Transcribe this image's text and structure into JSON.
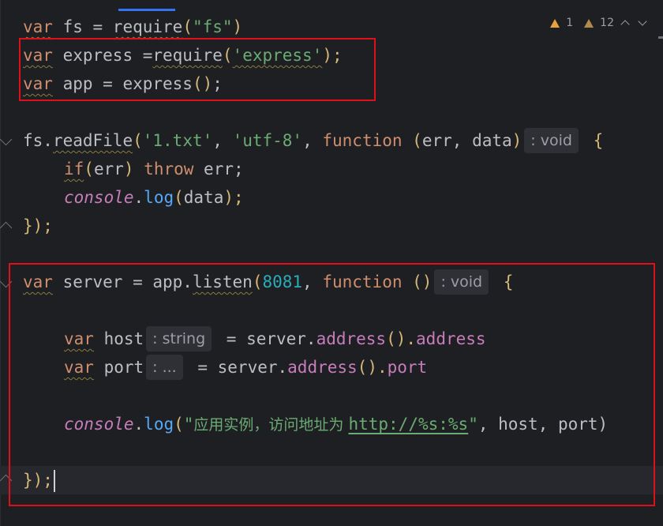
{
  "inspections": {
    "warnings_count": "1",
    "weak_warnings_count": "12"
  },
  "hints": {
    "void1": ": void",
    "void2": ": void",
    "string": ": string",
    "ellipsis": ": ..."
  },
  "code": {
    "l1": {
      "t1": "var",
      "t2": " fs = ",
      "t3": "require",
      "t4": "(",
      "t5": "\"fs\"",
      "t6": ")"
    },
    "l2": {
      "t1": "var",
      "t2": " express =",
      "t3": "require",
      "t4": "(",
      "t5": "'express'",
      "t6": ");"
    },
    "l3": {
      "t1": "var",
      "t2": " app = express",
      "t3": "()",
      "t4": ";"
    },
    "l5": {
      "t1": "fs.",
      "t2": "readFile",
      "t3": "(",
      "t4": "'1.txt'",
      "t5": ", ",
      "t6": "'utf-8'",
      "t7": ", ",
      "t8": "function",
      "t9": " (",
      "t10": "err",
      "t11": ", ",
      "t12": "data",
      "t13": ")",
      "t14": " {"
    },
    "l6": {
      "t1": "if",
      "t2": "(",
      "t3": "err",
      "t4": ")",
      "t5": " throw",
      "t6": " err;"
    },
    "l7": {
      "t1": "console",
      "t2": ".",
      "t3": "log",
      "t4": "(",
      "t5": "data",
      "t6": ");"
    },
    "l8": {
      "t1": "}",
      "t2": ");"
    },
    "l10": {
      "t1": "var",
      "t2": " server = app.",
      "t3": "listen",
      "t4": "(",
      "t5": "8081",
      "t6": ", ",
      "t7": "function",
      "t8": " ()",
      "t9": " {"
    },
    "l12": {
      "t1": "var",
      "t2": " host",
      "t3": " = server.",
      "t4": "address",
      "t5": "().",
      "t6": "address"
    },
    "l13": {
      "t1": "var",
      "t2": " port",
      "t3": " = server.",
      "t4": "address",
      "t5": "().",
      "t6": "port"
    },
    "l15": {
      "t1": "console",
      "t2": ".",
      "t3": "log",
      "t4": "(",
      "t5": "\"",
      "t6": "应用实例，访问地址为 ",
      "t7": "http://%s:%s",
      "t8": "\"",
      "t9": ", host, port)"
    },
    "l17": {
      "t1": "}",
      "t2": ");"
    }
  },
  "colors": {
    "background": "#1e1f22",
    "keyword": "#cf8e6d",
    "string": "#6aab73",
    "number": "#2aacb8",
    "function": "#56a8f5",
    "property": "#c77dbb",
    "highlight_box": "#e0101a"
  }
}
